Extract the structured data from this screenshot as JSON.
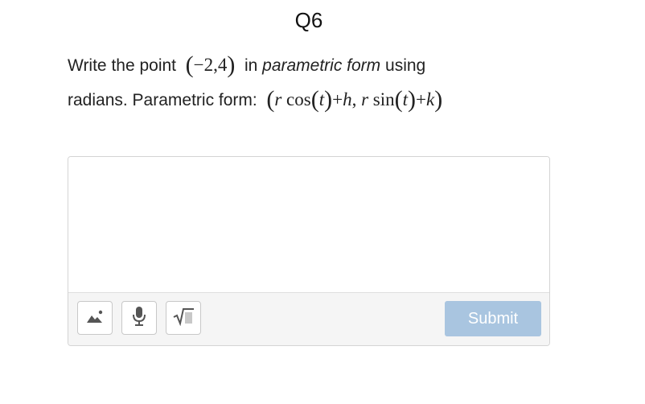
{
  "question": {
    "title": "Q6",
    "line1_prefix": "Write the point",
    "point": "(−2,4)",
    "line1_mid": "in",
    "line1_em": "parametric form",
    "line1_suffix": "using",
    "line2_prefix": "radians. Parametric form:",
    "formula": "(r cos(t)+h, r sin(t)+k)"
  },
  "answer": {
    "placeholder": "",
    "value": ""
  },
  "toolbar": {
    "tools": [
      {
        "name": "insert-image",
        "icon": "image-icon"
      },
      {
        "name": "record-audio",
        "icon": "microphone-icon"
      },
      {
        "name": "insert-math",
        "icon": "square-root-icon"
      }
    ],
    "submit_label": "Submit"
  },
  "colors": {
    "submit_bg": "#a9c5e0",
    "toolbar_bg": "#f5f5f5",
    "border": "#d4d4d4",
    "icon": "#555555"
  }
}
